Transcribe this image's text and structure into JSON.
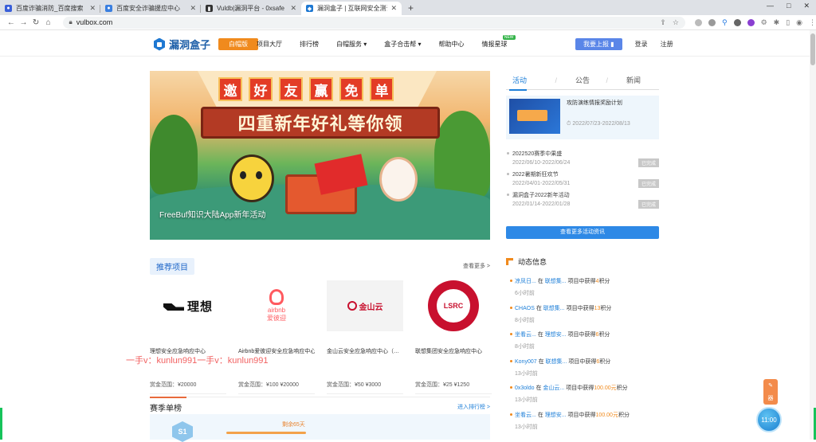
{
  "browser": {
    "tabs": [
      {
        "label": "百度诈骗消防_百度搜索",
        "color": "#3a5fd9",
        "active": false
      },
      {
        "label": "百度安全诈骗援应中心",
        "color": "#3a7fe0",
        "active": false
      },
      {
        "label": "Vuldb|漏洞平台 - 0xsafe",
        "color": "#333333",
        "active": false
      },
      {
        "label": "漏洞盒子 | 互联网安全测试众测",
        "color": "#1e78d2",
        "active": true
      }
    ],
    "url": "vulbox.com",
    "win_controls": [
      "—",
      "□",
      "✕"
    ]
  },
  "site": {
    "logo_text": "漏洞盒子",
    "logo_badge": "白帽版",
    "nav": [
      "项目大厅",
      "排行榜",
      "白帽服务 ▾",
      "盒子合击帮 ▾",
      "帮助中心",
      "情报星球"
    ],
    "nav_new_tag": "NEW",
    "report_button": "我要上报 ▮",
    "login": "登录",
    "register": "注册"
  },
  "banner": {
    "title_chars": [
      "邀",
      "好",
      "友",
      "赢",
      "免",
      "单"
    ],
    "subtitle": "四重新年好礼等你领",
    "caption": "FreeBuf知识大陆App新年活动"
  },
  "side": {
    "tabs": [
      "活动",
      "公告",
      "新闻"
    ],
    "featured": {
      "title": "攻防演练情报奖励计划",
      "date": "2022/07/23-2022/08/13"
    },
    "activities": [
      {
        "title": "2022520赛季中果盛",
        "date": "2022/06/10-2022/06/24",
        "status": "已完成"
      },
      {
        "title": "2022暑期新狂欢节",
        "date": "2022/04/01-2022/05/31",
        "status": "已完成"
      },
      {
        "title": "漏洞盒子2022新年活动",
        "date": "2022/01/14-2022/01/28",
        "status": "已完成"
      }
    ],
    "more_button": "查看更多活动资讯"
  },
  "recommend": {
    "title": "推荐项目",
    "more": "查看更多 >",
    "cards": [
      {
        "name": "理想安全应急响应中心",
        "range": "赏金范围：¥20000",
        "logo": "理想"
      },
      {
        "name": "Airbnb爱彼迎安全应急响应中心",
        "range": "赏金范围：¥100 ¥20000",
        "logo": "airbnb",
        "logo_sub": "爱彼迎"
      },
      {
        "name": "金山云安全应急响应中心（…",
        "range": "赏金范围：¥50 ¥3000",
        "logo": "金山云"
      },
      {
        "name": "联想集团安全应急响应中心",
        "range": "赏金范围：¥25 ¥1250",
        "logo": "LSRC"
      }
    ]
  },
  "watermark": "一手v：kunlun991一手v：kunlun991",
  "rank": {
    "title": "赛季单榜",
    "more": "进入排行榜 >",
    "badge": "S1",
    "tag": "剩余65天"
  },
  "dynamics": {
    "title": "动态信息",
    "items": [
      {
        "user": "凉凤日...",
        "verb": " 在 ",
        "project": "联想集...",
        "rest": " 项目中获得",
        "points": "4",
        "unit": "积分",
        "time": "6小时前"
      },
      {
        "user": "CHAOS",
        "verb": " 在 ",
        "project": "联想集...",
        "rest": " 项目中获得",
        "points": "13",
        "unit": "积分",
        "time": "8小时前"
      },
      {
        "user": "坐看云...",
        "verb": " 在 ",
        "project": "理想安...",
        "rest": " 项目中获得",
        "points": "6",
        "unit": "积分",
        "time": "8小时前"
      },
      {
        "user": "Kony007",
        "verb": " 在 ",
        "project": "联想集...",
        "rest": " 项目中获得",
        "points": "6",
        "unit": "积分",
        "time": "13小时前"
      },
      {
        "user": "0x3oldo",
        "verb": " 在 ",
        "project": "金山云...",
        "rest": " 项目中获得",
        "points": "100.00元",
        "unit": "积分",
        "time": "13小时前"
      },
      {
        "user": "坐看云...",
        "verb": " 在 ",
        "project": "理想安...",
        "rest": " 项目中获得",
        "points": "100.00元",
        "unit": "积分",
        "time": "13小时前"
      }
    ]
  },
  "float": {
    "icon1": "✎",
    "icon2": "器",
    "clock": "11:00"
  }
}
